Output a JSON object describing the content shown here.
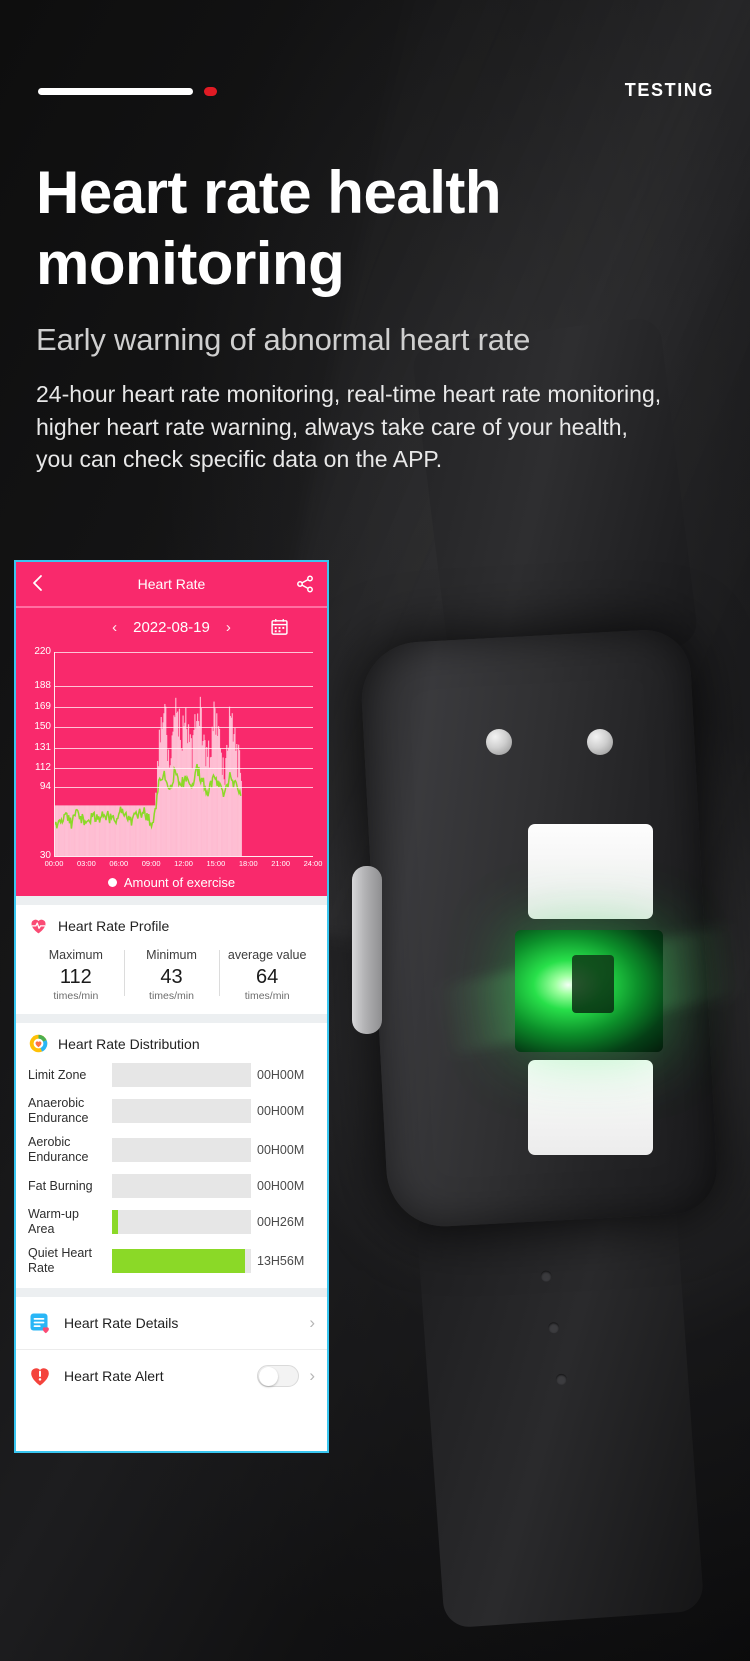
{
  "topbar": {
    "testing_label": "TESTING",
    "progress_icon": "progress-bar",
    "dot_color": "#e01b24"
  },
  "hero": {
    "headline": "Heart rate health monitoring",
    "subhead": "Early warning of abnormal heart rate",
    "body": "24-hour heart rate monitoring, real-time heart rate monitoring, higher heart rate warning, always take care of your health, you can check specific data on the APP."
  },
  "app": {
    "accent_color": "#f9296c",
    "border_color": "#39c6f0",
    "header": {
      "title": "Heart Rate",
      "back_icon": "back-chevron-icon",
      "share_icon": "share-icon"
    },
    "date_bar": {
      "prev_icon": "chevron-left-icon",
      "date": "2022-08-19",
      "next_icon": "chevron-right-icon",
      "calendar_icon": "calendar-icon"
    },
    "profile": {
      "icon": "heart-pulse-icon",
      "title": "Heart Rate Profile",
      "stats": [
        {
          "label": "Maximum",
          "value": "112",
          "unit": "times/min"
        },
        {
          "label": "Minimum",
          "value": "43",
          "unit": "times/min"
        },
        {
          "label": "average value",
          "value": "64",
          "unit": "times/min"
        }
      ]
    },
    "distribution": {
      "icon": "donut-heart-icon",
      "title": "Heart Rate Distribution",
      "bar_color": "#8bd927",
      "track_color": "#e6e6e6",
      "rows": [
        {
          "name": "Limit Zone",
          "value": "00H00M",
          "pct": 0
        },
        {
          "name": "Anaerobic Endurance",
          "value": "00H00M",
          "pct": 0
        },
        {
          "name": "Aerobic Endurance",
          "value": "00H00M",
          "pct": 0
        },
        {
          "name": "Fat Burning",
          "value": "00H00M",
          "pct": 0
        },
        {
          "name": "Warm-up Area",
          "value": "00H26M",
          "pct": 4
        },
        {
          "name": "Quiet Heart Rate",
          "value": "13H56M",
          "pct": 96
        }
      ]
    },
    "footer_rows": [
      {
        "icon": "details-list-icon",
        "label": "Heart Rate Details",
        "chevron": "›",
        "has_toggle": false
      },
      {
        "icon": "alert-heart-icon",
        "label": "Heart Rate Alert",
        "chevron": "›",
        "has_toggle": true,
        "toggle_on": false
      }
    ]
  },
  "chart_data": {
    "type": "line",
    "title": "Heart Rate",
    "xlabel": "",
    "ylabel": "",
    "ylim": [
      30,
      220
    ],
    "grid": true,
    "legend_position": "bottom",
    "background_color": "#f9296c",
    "y_ticks": [
      220,
      188,
      169,
      150,
      131,
      112,
      94,
      30
    ],
    "x_ticks": [
      "00:00",
      "03:00",
      "06:00",
      "09:00",
      "12:00",
      "15:00",
      "18:00",
      "21:00",
      "24:00"
    ],
    "legend": [
      "Amount of exercise"
    ],
    "series": [
      {
        "name": "Heart rate",
        "color": "#8bd927",
        "x": [
          "00:10",
          "00:40",
          "01:10",
          "01:40",
          "02:10",
          "02:40",
          "03:10",
          "03:40",
          "04:10",
          "04:40",
          "05:10",
          "05:40",
          "06:10",
          "06:40",
          "07:10",
          "07:40",
          "08:10",
          "08:40",
          "09:10",
          "09:40",
          "10:10",
          "10:40",
          "11:10",
          "11:40",
          "12:10",
          "12:40",
          "13:10",
          "13:40",
          "14:10",
          "14:40",
          "15:10",
          "15:40",
          "16:10",
          "16:40",
          "17:10"
        ],
        "values": [
          62,
          58,
          66,
          61,
          72,
          64,
          59,
          68,
          63,
          70,
          65,
          61,
          74,
          69,
          63,
          67,
          72,
          66,
          61,
          98,
          104,
          92,
          110,
          97,
          101,
          95,
          112,
          99,
          90,
          103,
          96,
          88,
          104,
          95,
          86
        ]
      },
      {
        "name": "Amount of exercise",
        "color": "#ffd7e4",
        "x": [
          "00:10",
          "00:40",
          "01:10",
          "01:40",
          "02:10",
          "02:40",
          "03:10",
          "03:40",
          "04:10",
          "04:40",
          "05:10",
          "05:40",
          "06:10",
          "06:40",
          "07:10",
          "07:40",
          "08:10",
          "08:40",
          "09:10",
          "09:40",
          "10:10",
          "10:40",
          "11:10",
          "11:40",
          "12:10",
          "12:40",
          "13:10",
          "13:40",
          "14:10",
          "14:40",
          "15:10",
          "15:40",
          "16:10",
          "16:40",
          "17:10"
        ],
        "values": [
          4,
          3,
          6,
          4,
          8,
          5,
          3,
          7,
          5,
          9,
          6,
          4,
          10,
          8,
          5,
          7,
          12,
          9,
          6,
          72,
          88,
          54,
          95,
          70,
          80,
          62,
          98,
          74,
          58,
          84,
          66,
          50,
          90,
          68,
          46
        ]
      }
    ]
  }
}
